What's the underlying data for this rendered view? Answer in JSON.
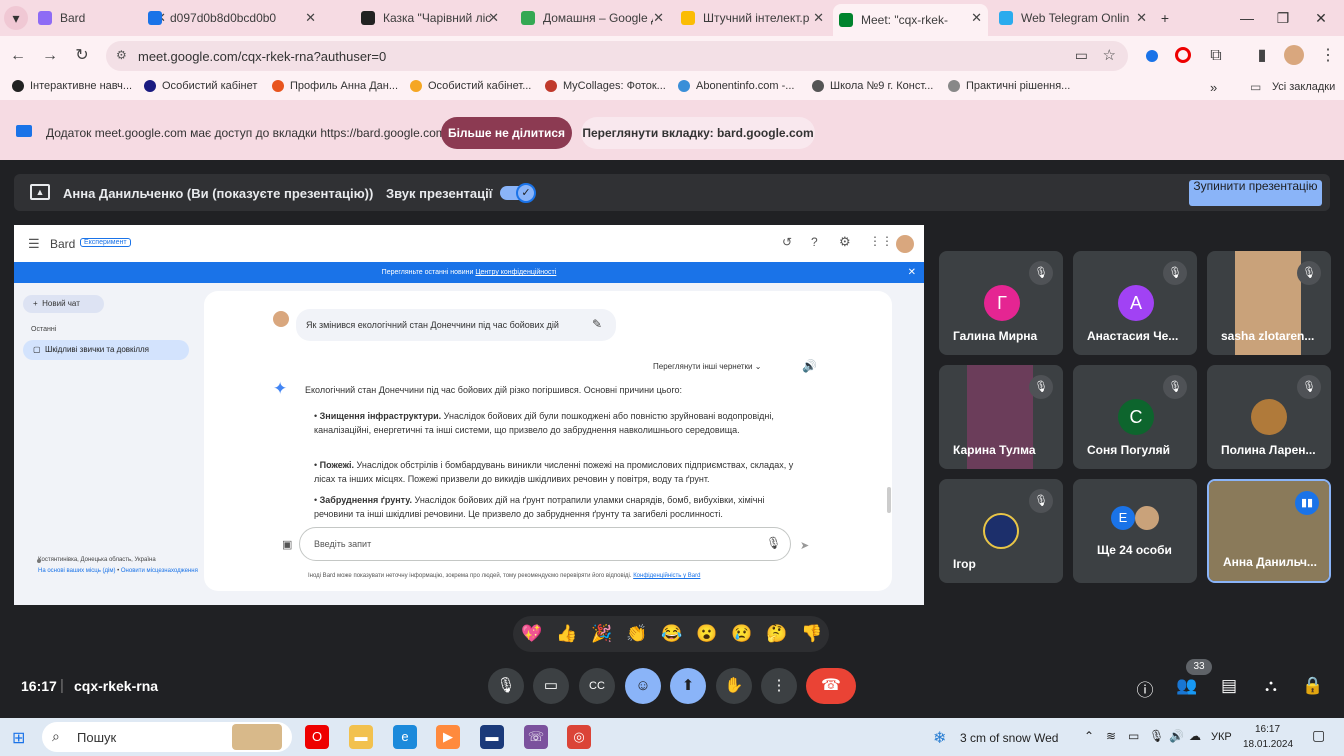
{
  "browser": {
    "tabs": [
      {
        "title": "Bard",
        "color": "#8e6bf5",
        "active": false
      },
      {
        "title": "d097d0b8d0bcd0b0",
        "color": "#1a73e8",
        "active": false
      },
      {
        "title": "Казка \"Чарівний ліс",
        "color": "#222222",
        "active": false
      },
      {
        "title": "Домашня – Google Д",
        "color": "#34a853",
        "active": false
      },
      {
        "title": "Штучний інтелект.р",
        "color": "#fbbc04",
        "active": false
      },
      {
        "title": "Meet: \"cqx-rkek-",
        "color": "#00832d",
        "active": true
      },
      {
        "title": "Web Telegram Onlin",
        "color": "#2aabee",
        "active": false
      }
    ],
    "new_tab": "+",
    "url": "meet.google.com/cqx-rkek-rna?authuser=0",
    "bookmarks": [
      {
        "label": "Інтерактивне навч...",
        "color": "#222"
      },
      {
        "label": "Особистий кабінет",
        "color": "#1a1a80"
      },
      {
        "label": "Профиль Анна Дан...",
        "color": "#e8541d"
      },
      {
        "label": "Особистий кабінет...",
        "color": "#f5a623"
      },
      {
        "label": "MyCollages: Фоток...",
        "color": "#c0392b"
      },
      {
        "label": "Abonentinfo.com -...",
        "color": "#3a8fd8"
      },
      {
        "label": "Школа №9 г. Конст...",
        "color": "#555"
      },
      {
        "label": "Практичні рішення...",
        "color": "#888"
      }
    ],
    "all_bookmarks": "Усі закладки",
    "bookmarks_more": "»"
  },
  "sharebar": {
    "message": "Додаток meet.google.com має доступ до вкладки https://bard.google.com",
    "stop_label": "Більше не ділитися",
    "view_label": "Переглянути вкладку: bard.google.com"
  },
  "presentation": {
    "presenter": "Анна Данильченко (Ви (показуєте презентацію))",
    "sound_label": "Звук презентації",
    "sound_on": true,
    "stop_label": "Зупинити презентацію"
  },
  "bard": {
    "logo": "Bard",
    "badge": "Експеримент",
    "banner": "Перегляньте останні новини",
    "banner_link": "Центру конфіденційності",
    "new_chat": "Новий чат",
    "recent_label": "Останні",
    "recent_item": "Шкідливі звички та довкілля",
    "location": "Костянтинівка, Донецька область, Україна",
    "location_link1": "На основі ваших місць (дім)",
    "location_sep": " • ",
    "location_link2": "Оновити місцезнаходження",
    "question": "Як змінився екологічний стан Донеччини під час бойових дій",
    "drafts": "Переглянути інші чернетки",
    "answer_intro": "Екологічний стан Донеччини під час бойових дій різко погіршився. Основні причини цього:",
    "bullets": [
      {
        "head": "Знищення інфраструктури.",
        "text": " Унаслідок бойових дій були пошкоджені або повністю зруйновані водопровідні, каналізаційні, енергетичні та інші системи, що призвело до забруднення навколишнього середовища."
      },
      {
        "head": "Пожежі.",
        "text": " Унаслідок обстрілів і бомбардувань виникли численні пожежі на промислових підприємствах, складах, у лісах та інших місцях. Пожежі призвели до викидів шкідливих речовин у повітря, воду та ґрунт."
      },
      {
        "head": "Забруднення ґрунту.",
        "text": " Унаслідок бойових дій на ґрунт потрапили уламки снарядів, бомб, вибухівки, хімічні речовини та інші шкідливі речовини. Це призвело до забруднення ґрунту та загибелі рослинності."
      }
    ],
    "input_placeholder": "Введіть запит",
    "disclaimer": "Іноді Bard може показувати неточну інформацію, зокрема про людей, тому рекомендуємо перевіряти його відповіді.",
    "disclaimer_link": "Конфіденційність у Bard"
  },
  "participants": [
    {
      "name": "Галина Мирна",
      "initial": "Г",
      "color": "#e52592",
      "photo": false
    },
    {
      "name": "Анастасия Че...",
      "initial": "А",
      "color": "#a142f4",
      "photo": false
    },
    {
      "name": "sasha zlotaren...",
      "initial": "",
      "color": "#c9a27a",
      "photo": true
    },
    {
      "name": "Карина Тулма",
      "initial": "",
      "color": "#6b3d5a",
      "photo": true
    },
    {
      "name": "Соня Погуляй",
      "initial": "С",
      "color": "#0d652d",
      "photo": false
    },
    {
      "name": "Полина Ларен...",
      "initial": "",
      "color": "#b07a3a",
      "photo": true
    },
    {
      "name": "Ігор",
      "initial": "",
      "color": "#1c2f6b",
      "photo": true
    },
    {
      "name": "Ще 24 особи",
      "initial": "Е",
      "color": "#1a73e8",
      "photo": false
    },
    {
      "name": "Анна Данильч...",
      "initial": "",
      "color": "#8a7a5a",
      "photo": true
    }
  ],
  "reactions": [
    "💖",
    "👍",
    "🎉",
    "👏",
    "😂",
    "😮",
    "😢",
    "🤔",
    "👎"
  ],
  "meeting": {
    "time": "16:17",
    "separator": "|",
    "code": "cqx-rkek-rna",
    "people_count": "33"
  },
  "taskbar": {
    "search": "Пошук",
    "weather": "3 cm of snow Wed",
    "lang": "УКР",
    "time": "16:17",
    "date": "18.01.2024"
  },
  "colors": {
    "accent": "#8ab4f8",
    "end_call": "#ea4335",
    "share_stop": "#8c3a52"
  }
}
